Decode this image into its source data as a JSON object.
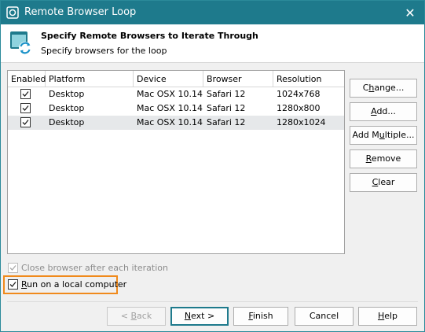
{
  "window": {
    "title": "Remote Browser Loop",
    "close_glyph": "✕",
    "titlebar_color": "#1e7a8c",
    "highlight_color": "#f08a1c"
  },
  "header": {
    "title": "Specify Remote Browsers to Iterate Through",
    "subtitle": "Specify browsers for the loop",
    "icon": "refresh-browser-icon"
  },
  "grid": {
    "columns": [
      "Enabled",
      "Platform",
      "Device",
      "Browser",
      "Resolution"
    ],
    "rows": [
      {
        "enabled": true,
        "platform": "Desktop",
        "device": "Mac OSX 10.14",
        "browser": "Safari 12",
        "resolution": "1024x768",
        "selected": false
      },
      {
        "enabled": true,
        "platform": "Desktop",
        "device": "Mac OSX 10.14",
        "browser": "Safari 12",
        "resolution": "1280x800",
        "selected": false
      },
      {
        "enabled": true,
        "platform": "Desktop",
        "device": "Mac OSX 10.14",
        "browser": "Safari 12",
        "resolution": "1280x1024",
        "selected": true
      }
    ]
  },
  "side_buttons": {
    "change": {
      "prefix": "C",
      "accel": "h",
      "suffix": "ange..."
    },
    "add": {
      "prefix": "",
      "accel": "A",
      "suffix": "dd..."
    },
    "add_multiple": {
      "prefix": "Add M",
      "accel": "u",
      "suffix": "ltiple..."
    },
    "remove": {
      "prefix": "",
      "accel": "R",
      "suffix": "emove"
    },
    "clear": {
      "prefix": "",
      "accel": "C",
      "suffix": "lear"
    }
  },
  "options": {
    "close_browser": {
      "label": "Close browser after each iteration",
      "checked": true,
      "disabled": true
    },
    "run_local": {
      "prefix": "",
      "accel": "R",
      "suffix": "un on a local computer",
      "checked": true
    }
  },
  "footer": {
    "back": {
      "prefix": "< ",
      "accel": "B",
      "suffix": "ack"
    },
    "next": {
      "prefix": "",
      "accel": "N",
      "suffix": "ext >"
    },
    "finish": {
      "prefix": "",
      "accel": "F",
      "suffix": "inish"
    },
    "cancel": "Cancel",
    "help": {
      "prefix": "",
      "accel": "H",
      "suffix": "elp"
    }
  }
}
